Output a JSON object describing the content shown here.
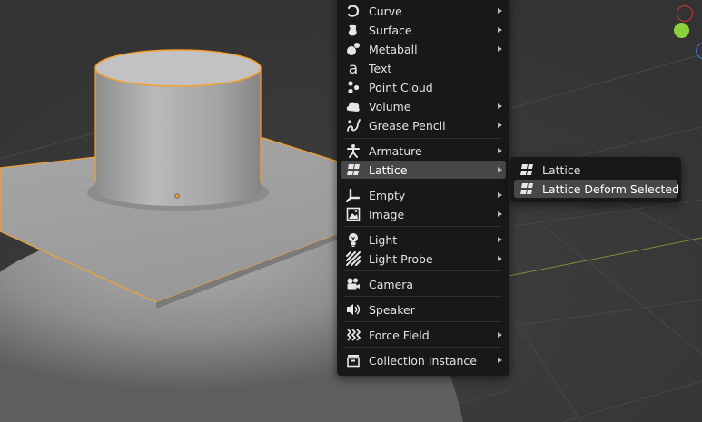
{
  "add_menu": {
    "items": [
      {
        "label": "Curve",
        "icon": "curve-icon",
        "has_submenu": true
      },
      {
        "label": "Surface",
        "icon": "surface-icon",
        "has_submenu": true
      },
      {
        "label": "Metaball",
        "icon": "metaball-icon",
        "has_submenu": true
      },
      {
        "label": "Text",
        "icon": "text-icon",
        "has_submenu": false
      },
      {
        "label": "Point Cloud",
        "icon": "point-cloud-icon",
        "has_submenu": false
      },
      {
        "label": "Volume",
        "icon": "volume-icon",
        "has_submenu": true
      },
      {
        "label": "Grease Pencil",
        "icon": "grease-pencil-icon",
        "has_submenu": true
      },
      {
        "label": "Armature",
        "icon": "armature-icon",
        "has_submenu": true
      },
      {
        "label": "Lattice",
        "icon": "lattice-icon",
        "has_submenu": true,
        "active": true
      },
      {
        "label": "Empty",
        "icon": "empty-icon",
        "has_submenu": true
      },
      {
        "label": "Image",
        "icon": "image-icon",
        "has_submenu": true
      },
      {
        "label": "Light",
        "icon": "light-icon",
        "has_submenu": true
      },
      {
        "label": "Light Probe",
        "icon": "light-probe-icon",
        "has_submenu": true
      },
      {
        "label": "Camera",
        "icon": "camera-icon",
        "has_submenu": false
      },
      {
        "label": "Speaker",
        "icon": "speaker-icon",
        "has_submenu": false
      },
      {
        "label": "Force Field",
        "icon": "force-field-icon",
        "has_submenu": true
      },
      {
        "label": "Collection Instance",
        "icon": "collection-instance-icon",
        "has_submenu": true
      }
    ]
  },
  "lattice_submenu": {
    "items": [
      {
        "label": "Lattice",
        "icon": "lattice-icon"
      },
      {
        "label": "Lattice Deform Selected",
        "icon": "lattice-icon",
        "active": true
      }
    ]
  },
  "colors": {
    "menu_bg": "#181818",
    "highlight": "#474747",
    "selection_outline": "#f5a030",
    "gizmo_x": "#c8363c",
    "gizmo_y": "#8bd13b",
    "gizmo_z": "#3b7fd4"
  }
}
